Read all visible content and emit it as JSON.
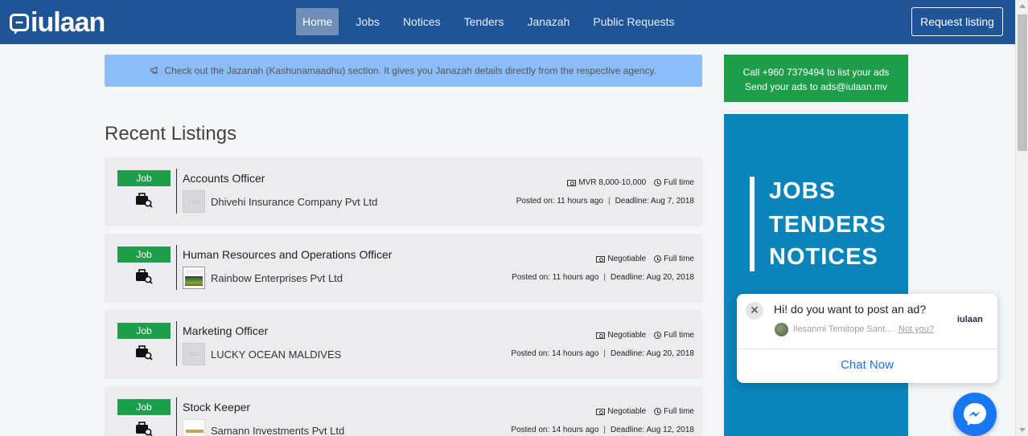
{
  "header": {
    "logo_text": "iulaan",
    "nav": [
      {
        "label": "Home",
        "active": true
      },
      {
        "label": "Jobs",
        "active": false
      },
      {
        "label": "Notices",
        "active": false
      },
      {
        "label": "Tenders",
        "active": false
      },
      {
        "label": "Janazah",
        "active": false
      },
      {
        "label": "Public Requests",
        "active": false
      }
    ],
    "request_button": "Request listing"
  },
  "announcement": {
    "icon": "bullhorn-icon",
    "text": "Check out the Jazanah (Kashunamaadhu) section. It gives you Janazah details directly from the respective agency."
  },
  "section_title": "Recent Listings",
  "listings": [
    {
      "badge": "Job",
      "title": "Accounts Officer",
      "company": "Dhivehi Insurance Company Pvt Ltd",
      "logo_placeholder": "LOGO",
      "salary": "MVR 8,000-10,000",
      "job_type": "Full time",
      "posted": "Posted on: 11 hours ago",
      "deadline": "Deadline: Aug 7, 2018"
    },
    {
      "badge": "Job",
      "title": "Human Resources and Operations Officer",
      "company": "Rainbow Enterprises Pvt Ltd",
      "logo_placeholder": "",
      "salary": "Negotiable",
      "job_type": "Full time",
      "posted": "Posted on: 11 hours ago",
      "deadline": "Deadline: Aug 20, 2018"
    },
    {
      "badge": "Job",
      "title": "Marketing Officer",
      "company": "LUCKY OCEAN MALDIVES",
      "logo_placeholder": "LOGO",
      "salary": "Negotiable",
      "job_type": "Full time",
      "posted": "Posted on: 14 hours ago",
      "deadline": "Deadline: Aug 20, 2018"
    },
    {
      "badge": "Job",
      "title": "Stock Keeper",
      "company": "Samann Investments Pvt Ltd",
      "logo_placeholder": "",
      "salary": "Negotiable",
      "job_type": "Full time",
      "posted": "Posted on: 14 hours ago",
      "deadline": "Deadline: Aug 12, 2018"
    }
  ],
  "sidebar": {
    "call_line1": "Call +960 7379494 to list your ads",
    "call_line2": "Send your ads to ads@iulaan.mv",
    "promo_lines": [
      "JOBS",
      "TENDERS",
      "NOTICES"
    ]
  },
  "chat": {
    "question": "Hi! do you want to post an ad?",
    "user": "Ilesanmi Temitope Sant...",
    "not_you": "Not you?",
    "logo": "iulaan",
    "cta": "Chat Now",
    "close": "✕"
  },
  "colors": {
    "navbar": "#1f5596",
    "badge_green": "#1e9e4a",
    "promo_blue": "#0b83bb",
    "announce_blue": "#8dbdf7",
    "messenger_blue": "#1877f2"
  }
}
